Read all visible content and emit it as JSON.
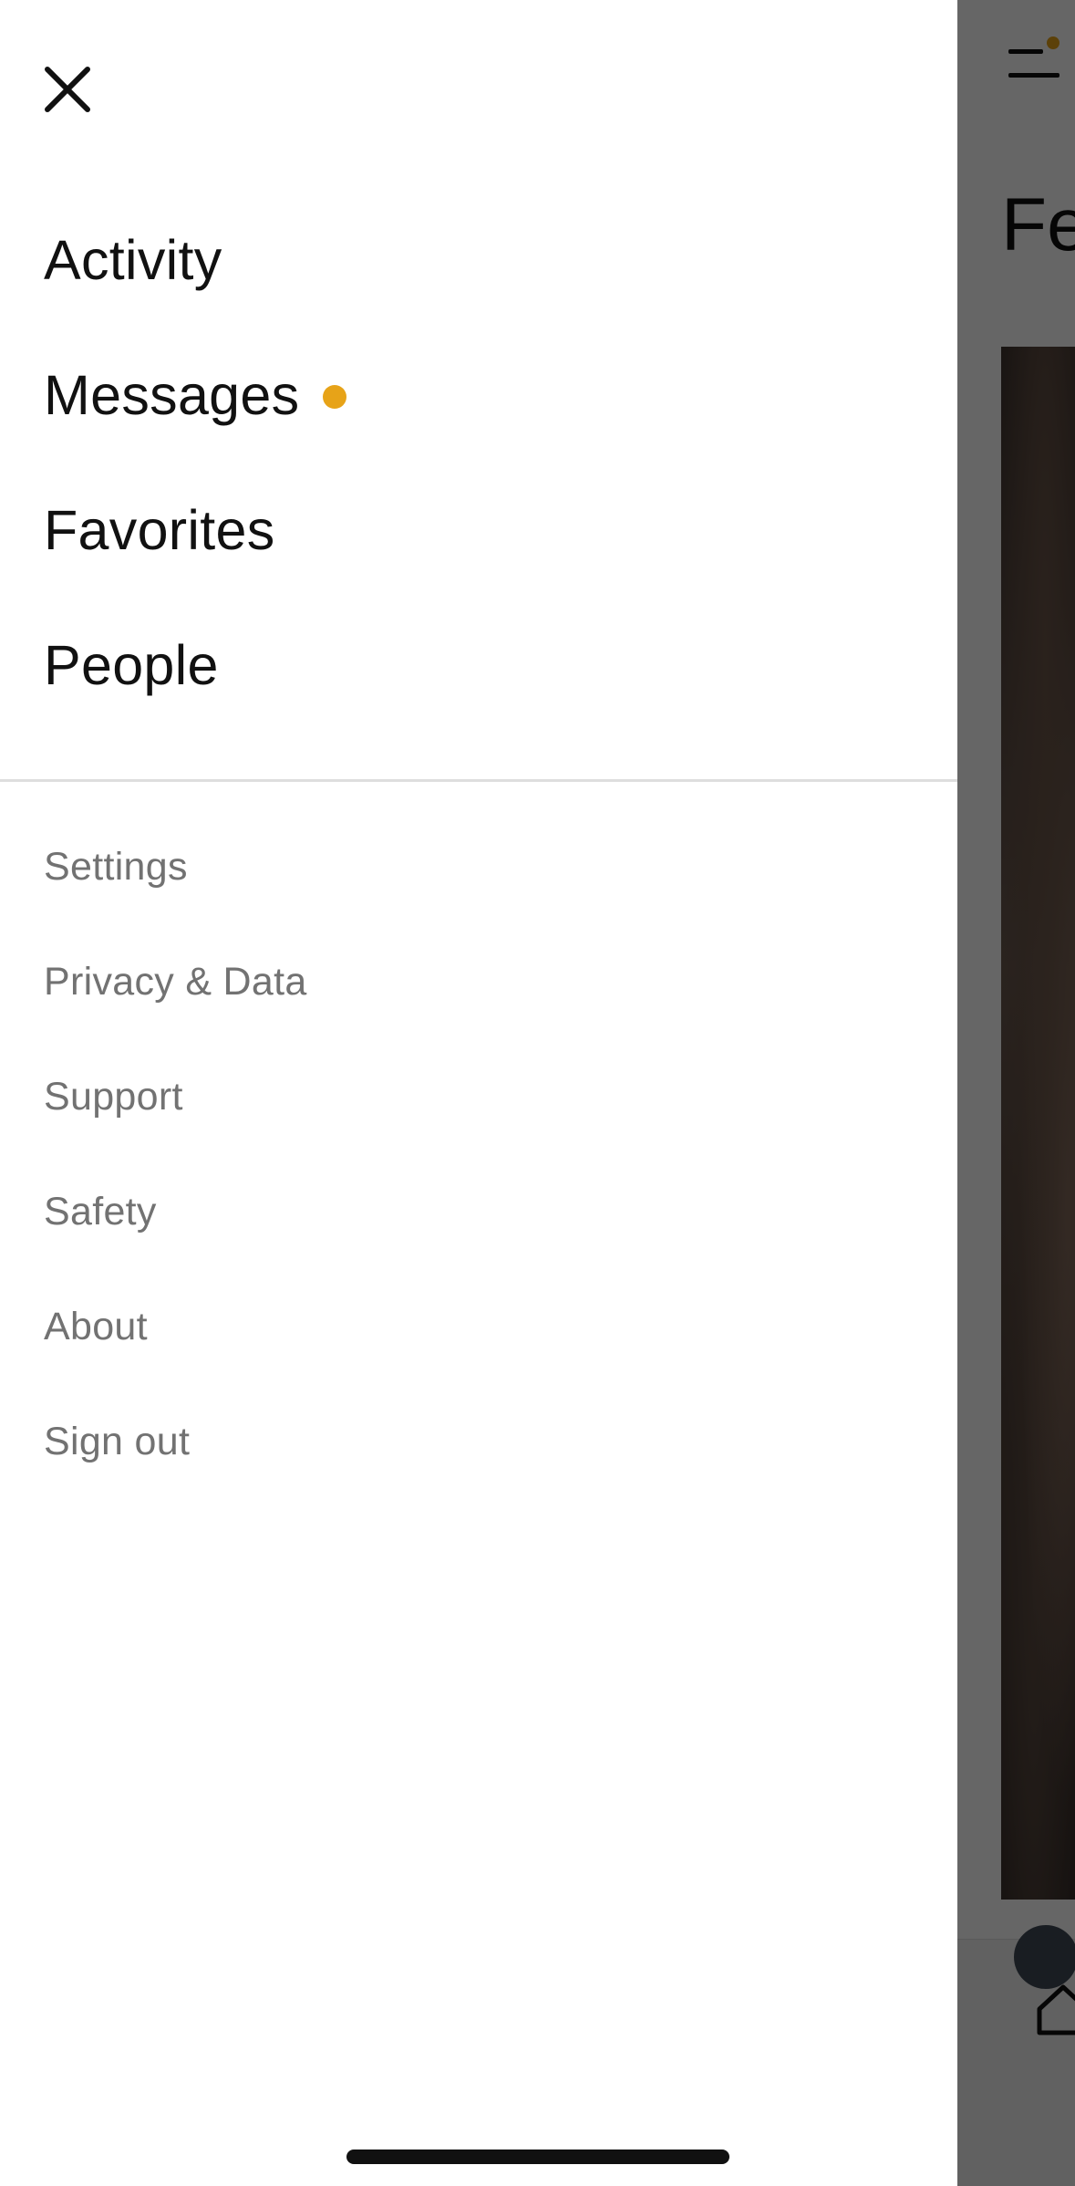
{
  "background_app": {
    "title_fragment": "Fe",
    "colors": {
      "notification_dot": "#e7a318",
      "scrim": "rgba(0,0,0,0.6)"
    },
    "icons": [
      "menu-icon",
      "home-icon"
    ]
  },
  "drawer": {
    "close_icon": "close-icon",
    "primary_items": [
      {
        "label": "Activity",
        "badge": false
      },
      {
        "label": "Messages",
        "badge": true
      },
      {
        "label": "Favorites",
        "badge": false
      },
      {
        "label": "People",
        "badge": false
      }
    ],
    "secondary_items": [
      {
        "label": "Settings"
      },
      {
        "label": "Privacy & Data"
      },
      {
        "label": "Support"
      },
      {
        "label": "Safety"
      },
      {
        "label": "About"
      },
      {
        "label": "Sign out"
      }
    ],
    "colors": {
      "primary_text": "#111111",
      "secondary_text": "#727272",
      "badge": "#e7a318",
      "divider": "#dedede"
    }
  }
}
